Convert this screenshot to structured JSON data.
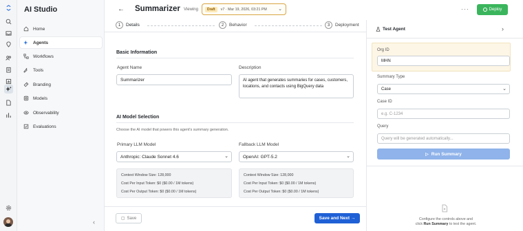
{
  "app": {
    "title": "AI Studio"
  },
  "nav": {
    "items": [
      {
        "label": "Home",
        "icon": "home-icon"
      },
      {
        "label": "Agents",
        "icon": "agents-icon",
        "active": true
      },
      {
        "label": "Workflows",
        "icon": "workflows-icon"
      },
      {
        "label": "Tools",
        "icon": "tools-icon"
      },
      {
        "label": "Branding",
        "icon": "branding-icon"
      },
      {
        "label": "Models",
        "icon": "models-icon"
      },
      {
        "label": "Observability",
        "icon": "observability-icon"
      },
      {
        "label": "Evaluations",
        "icon": "evaluations-icon"
      }
    ],
    "collapse_glyph": "‹"
  },
  "header": {
    "back_glyph": "←",
    "title": "Summarizer",
    "viewing_label": "Viewing",
    "draft_badge": "Draft",
    "version_text": "v7 · Mar 19, 2026, 03:21 PM",
    "more_glyph": "···",
    "deploy_label": "Deploy"
  },
  "steps": [
    {
      "num": "1",
      "label": "Details",
      "active": true
    },
    {
      "num": "2",
      "label": "Behavior"
    },
    {
      "num": "3",
      "label": "Deployment"
    }
  ],
  "basic": {
    "section_title": "Basic Information",
    "name_label": "Agent Name",
    "name_value": "Summarizer",
    "description_label": "Description",
    "description_value": "AI agent that generates summaries for cases, customers, locations, and contacts using BigQuery data"
  },
  "model": {
    "section_title": "AI Model Selection",
    "hint": "Choose the AI model that powers this agent's summary generation.",
    "primary": {
      "label": "Primary LLM Model",
      "value": "Anthropic: Claude Sonnet 4.6",
      "context_window": "Context Window Size:  128,000",
      "input_cost": "Cost Per Input Token:  $0 ($0.00 / 1M tokens)",
      "output_cost": "Cost Per Output Token:  $0 ($0.00 / 1M tokens)"
    },
    "fallback": {
      "label": "Fallback LLM Model",
      "value": "OpenAI: GPT-5.2",
      "context_window": "Context Window Size:  128,000",
      "input_cost": "Cost Per Input Token:  $0 ($0.00 / 1M tokens)",
      "output_cost": "Cost Per Output Token:  $0 ($0.00 / 1M tokens)"
    }
  },
  "footer": {
    "save_label": "Save",
    "next_label": "Save and Next →"
  },
  "test_panel": {
    "title": "Test Agent",
    "close_glyph": "›",
    "org_id_label": "Org ID",
    "org_id_value": "MHN",
    "summary_type_label": "Summary Type",
    "summary_type_value": "Case",
    "case_id_label": "Case ID",
    "case_id_placeholder": "e.g. C-1234",
    "query_label": "Query",
    "query_placeholder": "Query will be generated automatically...",
    "run_label": "Run Summary",
    "empty_line1": "Configure the controls above and",
    "empty_line2_pre": "click ",
    "empty_line2_bold": "Run Summary",
    "empty_line2_post": " to test the agent."
  },
  "colors": {
    "primary": "#1f60d6",
    "deploy": "#3bb55d",
    "draft_bg": "#fde9b7",
    "run_disabled": "#8fb3ea"
  }
}
